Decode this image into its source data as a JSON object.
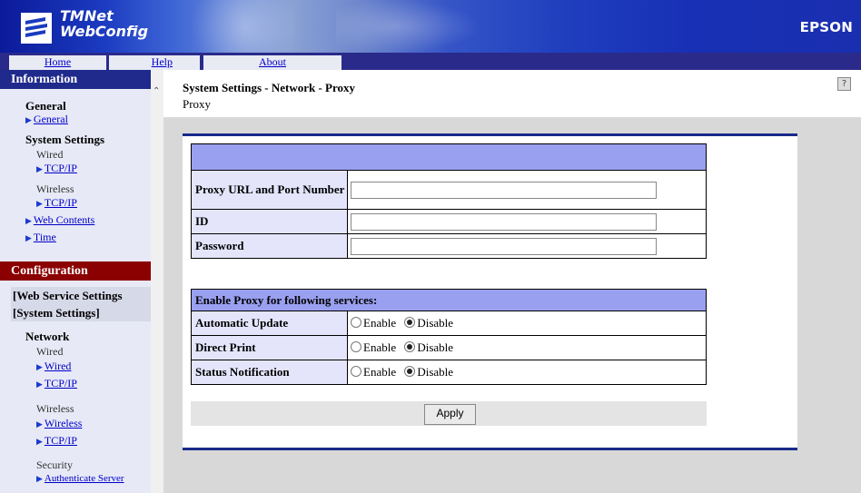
{
  "header": {
    "logo_line1": "TMNet",
    "logo_line2": "WebConfig",
    "brand": "EPSON"
  },
  "nav": {
    "home": "Home",
    "help": "Help",
    "about": "About"
  },
  "sidebar": {
    "information": "Information",
    "general_heading": "General",
    "general_link": "General",
    "system_settings_heading": "System Settings",
    "wired_label": "Wired",
    "wired_tcpip": "TCP/IP",
    "wireless_label": "Wireless",
    "wireless_tcpip": "TCP/IP",
    "web_contents": "Web Contents",
    "time": "Time",
    "configuration": "Configuration",
    "web_service_settings": "[Web Service Settings",
    "system_settings_bracket": "[System Settings]",
    "network_heading": "Network",
    "net_wired_label": "Wired",
    "net_wired_link": "Wired",
    "net_wired_tcpip": "TCP/IP",
    "net_wireless_label": "Wireless",
    "net_wireless_link": "Wireless",
    "net_wireless_tcpip": "TCP/IP",
    "security_label": "Security",
    "authenticate_server": "Authenticate Server"
  },
  "main": {
    "title": "System Settings - Network - Proxy",
    "subtitle": "Proxy",
    "help_icon": "?",
    "proxy_url_label": "Proxy URL and Port Number",
    "proxy_url_value": "",
    "id_label": "ID",
    "id_value": "",
    "password_label": "Password",
    "password_value": "",
    "services_header": "Enable Proxy for following services:",
    "enable_label": "Enable",
    "disable_label": "Disable",
    "services": [
      {
        "label": "Automatic Update",
        "selected": "Disable"
      },
      {
        "label": "Direct Print",
        "selected": "Disable"
      },
      {
        "label": "Status Notification",
        "selected": "Disable"
      }
    ],
    "apply_button": "Apply"
  },
  "colors": {
    "header_blue": "#1f3fbf",
    "info_header": "#1f2a8c",
    "config_header": "#8b0000",
    "table_header": "#9aa0f0",
    "label_bg": "#e4e5fb"
  }
}
